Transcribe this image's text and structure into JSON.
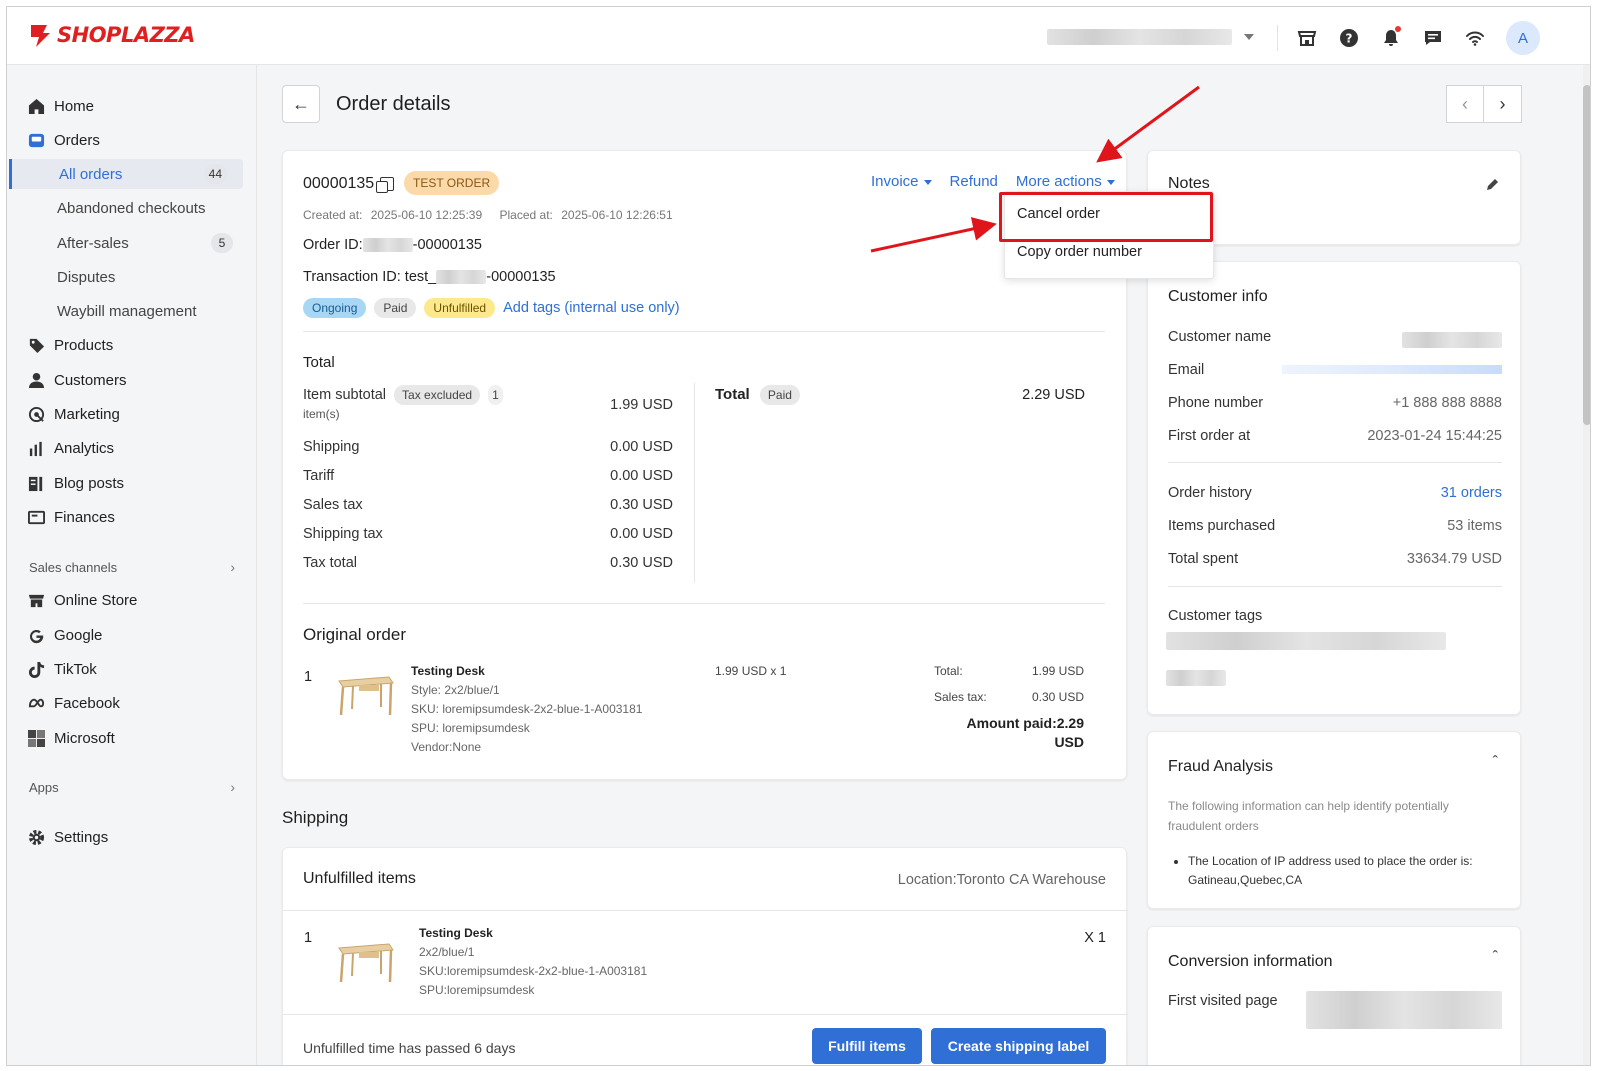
{
  "brand": {
    "name": "SHOPLAZZA",
    "color": "#e02020"
  },
  "topbar": {
    "icons": [
      "storefront-icon",
      "help-icon",
      "bell-icon",
      "chat-icon",
      "wifi-icon"
    ],
    "avatar": "A"
  },
  "sidebar": {
    "items": [
      {
        "label": "Home",
        "icon": "home-icon"
      },
      {
        "label": "Orders",
        "icon": "orders-icon"
      },
      {
        "label": "All orders",
        "count": "44"
      },
      {
        "label": "Abandoned checkouts"
      },
      {
        "label": "After-sales",
        "count": "5"
      },
      {
        "label": "Disputes"
      },
      {
        "label": "Waybill management"
      },
      {
        "label": "Products",
        "icon": "tag-icon"
      },
      {
        "label": "Customers",
        "icon": "person-icon"
      },
      {
        "label": "Marketing",
        "icon": "marketing-icon"
      },
      {
        "label": "Analytics",
        "icon": "bar-chart-icon"
      },
      {
        "label": "Blog posts",
        "icon": "blog-icon"
      },
      {
        "label": "Finances",
        "icon": "finance-icon"
      }
    ],
    "sales_channels_label": "Sales channels",
    "channels": [
      {
        "label": "Online Store",
        "icon": "store-icon"
      },
      {
        "label": "Google",
        "icon": "google-icon"
      },
      {
        "label": "TikTok",
        "icon": "tiktok-icon"
      },
      {
        "label": "Facebook",
        "icon": "meta-icon"
      },
      {
        "label": "Microsoft",
        "icon": "microsoft-icon"
      }
    ],
    "apps_label": "Apps",
    "settings_label": "Settings"
  },
  "page": {
    "title": "Order details"
  },
  "order": {
    "number": "00000135",
    "test_badge": "TEST ORDER",
    "created_label": "Created at:",
    "created_at": "2025-06-10 12:25:39",
    "placed_label": "Placed at:",
    "placed_at": "2025-06-10 12:26:51",
    "order_id_label": "Order ID:",
    "order_id_suffix": "-00000135",
    "transaction_label": "Transaction ID: test_",
    "transaction_suffix": "-00000135",
    "tags": [
      "Ongoing",
      "Paid",
      "Unfulfilled"
    ],
    "add_tags": "Add tags (internal use only)",
    "actions": {
      "invoice": "Invoice",
      "refund": "Refund",
      "more": "More actions"
    },
    "menu": {
      "cancel": "Cancel order",
      "copy": "Copy order number"
    }
  },
  "totals": {
    "title": "Total",
    "item_subtotal_label": "Item subtotal",
    "tax_excluded": "Tax excluded",
    "items_count": "1",
    "items_unit": "item(s)",
    "item_subtotal": "1.99 USD",
    "rows": [
      {
        "label": "Shipping",
        "value": "0.00 USD"
      },
      {
        "label": "Tariff",
        "value": "0.00 USD"
      },
      {
        "label": "Sales tax",
        "value": "0.30 USD"
      },
      {
        "label": "Shipping tax",
        "value": "0.00 USD"
      },
      {
        "label": "Tax total",
        "value": "0.30 USD"
      }
    ],
    "total_label": "Total",
    "paid_badge": "Paid",
    "total_value": "2.29 USD"
  },
  "original_order": {
    "title": "Original order",
    "qty": "1",
    "name": "Testing Desk",
    "style": "Style: 2x2/blue/1",
    "sku": "SKU: loremipsumdesk-2x2-blue-1-A003181",
    "spu": "SPU: loremipsumdesk",
    "vendor": "Vendor:None",
    "price_qty": "1.99 USD x 1",
    "total_label": "Total:",
    "total_value": "1.99 USD",
    "sales_tax_label": "Sales tax:",
    "sales_tax_value": "0.30 USD",
    "amount_paid": "Amount paid:2.29 USD"
  },
  "shipping": {
    "title": "Shipping",
    "unfulfilled_title": "Unfulfilled items",
    "location": "Location:Toronto CA Warehouse",
    "qty": "1",
    "name": "Testing Desk",
    "variant": "2x2/blue/1",
    "sku": "SKU:loremipsumdesk-2x2-blue-1-A003181",
    "spu": "SPU:loremipsumdesk",
    "multiplier": "X 1",
    "footer_text": "Unfulfilled time has passed 6 days",
    "fulfill_btn": "Fulfill items",
    "label_btn": "Create shipping label"
  },
  "notes": {
    "title": "Notes"
  },
  "customer": {
    "title": "Customer info",
    "name_label": "Customer name",
    "email_label": "Email",
    "phone_label": "Phone number",
    "phone": "+1 888 888 8888",
    "first_order_label": "First order at",
    "first_order": "2023-01-24 15:44:25",
    "history_label": "Order history",
    "history": "31 orders",
    "items_label": "Items purchased",
    "items": "53 items",
    "spent_label": "Total spent",
    "spent": "33634.79 USD",
    "tags_label": "Customer tags"
  },
  "fraud": {
    "title": "Fraud Analysis",
    "desc": "The following information can help identify potentially fraudulent orders",
    "bullet": "The Location of IP address used to place the order is: Gatineau,Quebec,CA"
  },
  "conversion": {
    "title": "Conversion information",
    "first_page_label": "First visited page"
  },
  "colors": {
    "accent": "#2f6fd6",
    "highlight": "#e0151b",
    "test_badge": "#fcd9a9"
  }
}
